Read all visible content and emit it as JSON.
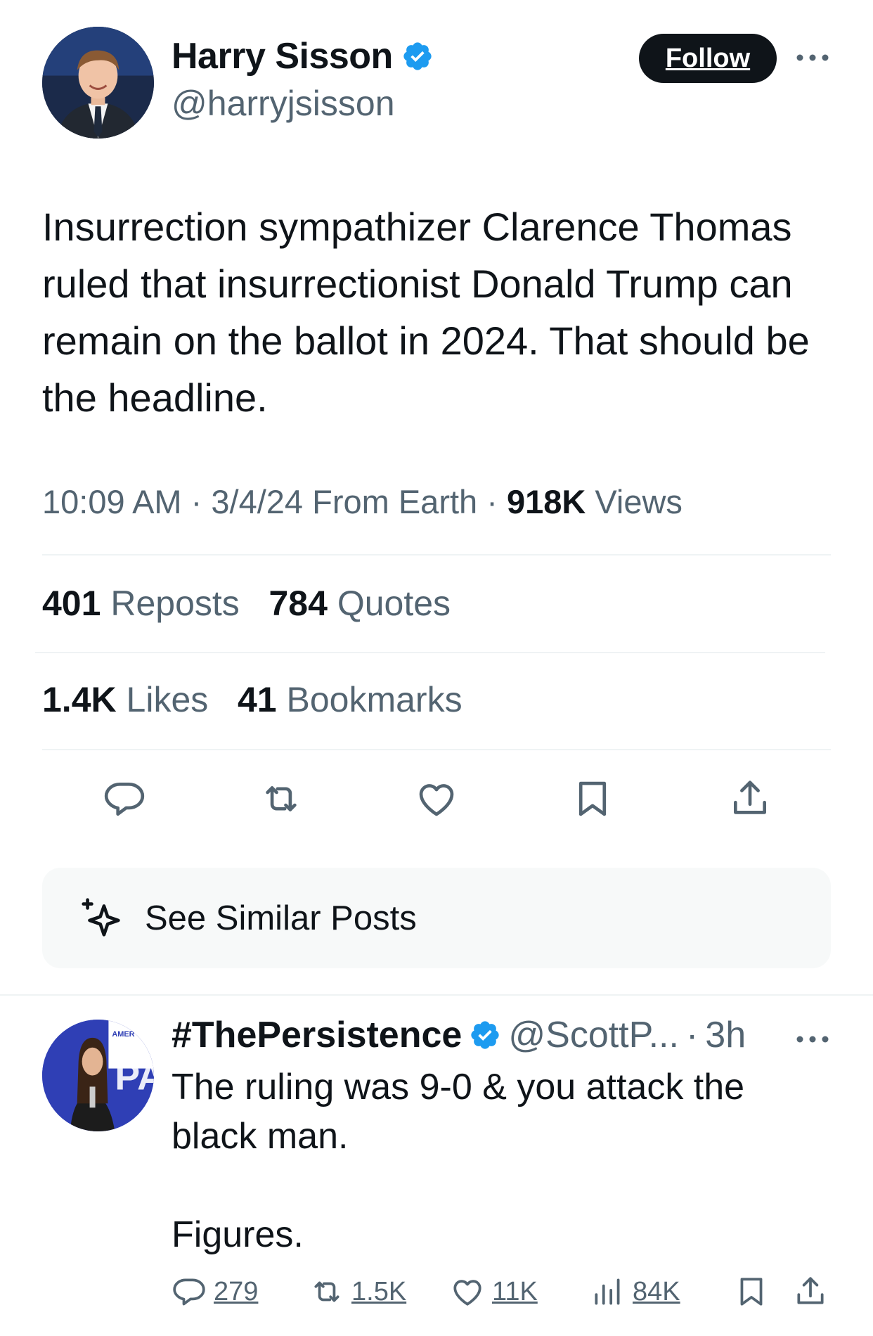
{
  "author": {
    "name": "Harry Sisson",
    "handle": "@harryjsisson",
    "verified": true,
    "follow_label": "Follow"
  },
  "tweet": {
    "text": "Insurrection sympathizer Clarence Thomas ruled that insurrectionist Donald Trump can remain on the ballot in 2024. That should be the headline.",
    "time": "10:09 AM",
    "date": "3/4/24",
    "source": "From Earth",
    "separator": "·",
    "views_count": "918K",
    "views_label": "Views"
  },
  "stats": {
    "reposts_count": "401",
    "reposts_label": "Reposts",
    "quotes_count": "784",
    "quotes_label": "Quotes",
    "likes_count": "1.4K",
    "likes_label": "Likes",
    "bookmarks_count": "41",
    "bookmarks_label": "Bookmarks"
  },
  "actions": [
    "reply-icon",
    "repost-icon",
    "like-icon",
    "bookmark-icon",
    "share-icon"
  ],
  "similar_posts_label": "See Similar Posts",
  "reply": {
    "name": "#ThePersistence",
    "verified": true,
    "handle": "@ScottP...",
    "separator": "·",
    "time": "3h",
    "avatar_text": "AMER CONSE UNION",
    "text": "The ruling was 9-0 & you attack the black man.\n\nFigures.",
    "replies": "279",
    "reposts": "1.5K",
    "likes": "11K",
    "views": "84K"
  },
  "colors": {
    "text": "#0f1419",
    "muted": "#536471",
    "verified_blue": "#1d9bf0",
    "divider": "#eff3f4",
    "follow_bg": "#0f1419"
  }
}
